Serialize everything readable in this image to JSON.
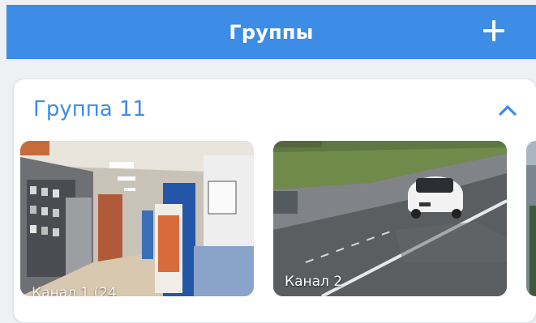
{
  "header": {
    "title": "Группы",
    "add_icon": "plus-icon"
  },
  "group": {
    "title": "Группа 11",
    "collapse_icon": "chevron-up-icon",
    "accent_color": "#3d8ce6",
    "channels": [
      {
        "label": "Канал 1 (24",
        "scene": "electronics-store-interior"
      },
      {
        "label": "Канал 2",
        "scene": "road-with-car-in-rain"
      },
      {
        "label": "",
        "scene": "partially-visible-camera-thumbnail"
      }
    ]
  }
}
